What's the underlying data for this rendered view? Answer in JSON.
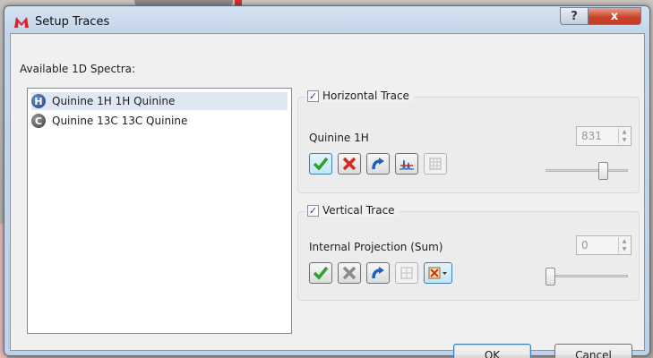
{
  "window": {
    "title": "Setup Traces"
  },
  "titlebar": {
    "help_label": "?",
    "close_label": "x"
  },
  "spectra": {
    "label": "Available 1D Spectra:",
    "items": [
      {
        "icon": "H",
        "label": "Quinine 1H 1H Quinine"
      },
      {
        "icon": "C",
        "label": "Quinine 13C 13C Quinine"
      }
    ]
  },
  "horizontal": {
    "title": "Horizontal Trace",
    "checked": true,
    "trace": "Quinine 1H",
    "spin_value": "831",
    "slider_fraction": 0.73
  },
  "vertical": {
    "title": "Vertical Trace",
    "checked": true,
    "trace": "Internal Projection (Sum)",
    "spin_value": "0",
    "slider_fraction": 0.0
  },
  "footer": {
    "ok_label": "OK",
    "cancel_label": "Cancel"
  },
  "colors": {
    "accept": "#2f9e2f",
    "reject": "#d8281c",
    "redo": "#1f5fb5",
    "title_bar": "#c5d6ea"
  }
}
